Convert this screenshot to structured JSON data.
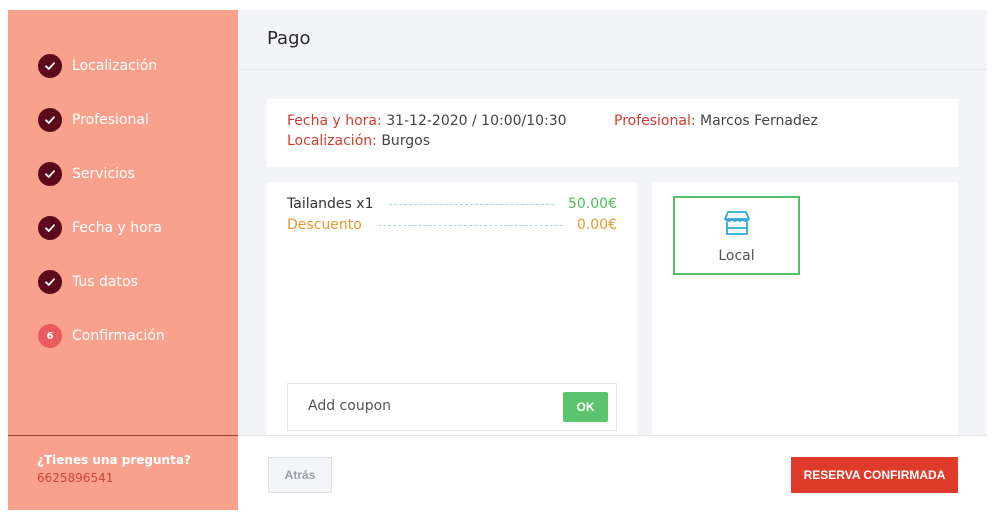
{
  "sidebar": {
    "steps": [
      {
        "label": "Localización",
        "state": "done",
        "icon": "check-icon"
      },
      {
        "label": "Profesional",
        "state": "done",
        "icon": "check-icon"
      },
      {
        "label": "Servicios",
        "state": "done",
        "icon": "check-icon"
      },
      {
        "label": "Fecha y hora",
        "state": "done",
        "icon": "check-icon"
      },
      {
        "label": "Tus datos",
        "state": "done",
        "icon": "check-icon"
      },
      {
        "label": "Confirmación",
        "state": "current",
        "number": "6"
      }
    ],
    "footer": {
      "question": "¿Tienes una pregunta?",
      "phone": "6625896541"
    }
  },
  "main": {
    "title": "Pago",
    "summary": {
      "date_label": "Fecha y hora:",
      "date_value": "31-12-2020 / 10:00/10:30",
      "professional_label": "Profesional:",
      "professional_value": "Marcos Fernadez",
      "location_label": "Localización:",
      "location_value": "Burgos"
    },
    "items": [
      {
        "name": "Tailandes x1",
        "price": "50.00€"
      },
      {
        "name": "Descuento",
        "price": "0.00€"
      }
    ],
    "coupon": {
      "placeholder": "Add coupon",
      "ok_label": "OK"
    },
    "payment_method": {
      "label": "Local",
      "icon": "store-icon"
    },
    "footer": {
      "back_label": "Atrás",
      "confirm_label": "RESERVA CONFIRMADA"
    }
  },
  "colors": {
    "sidebar_bg": "#f9a18c",
    "step_badge": "#5c0a1b",
    "current_badge": "#ea5a5e",
    "accent_red": "#de3b2a",
    "success_green": "#5cc36e",
    "discount_orange": "#e69a2a"
  }
}
